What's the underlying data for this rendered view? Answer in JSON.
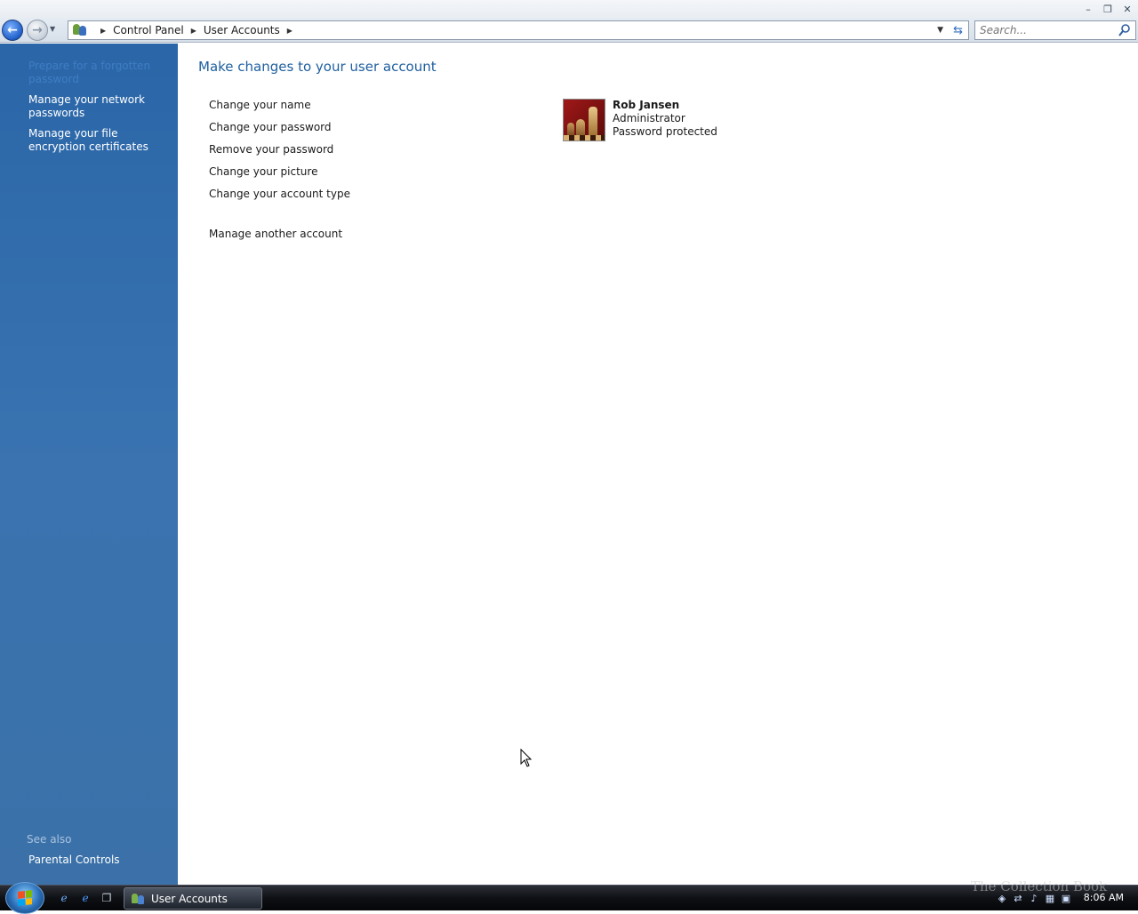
{
  "window": {
    "minimize_glyph": "–",
    "restore_glyph": "❐",
    "close_glyph": "✕"
  },
  "nav": {
    "back_glyph": "←",
    "forward_glyph": "→",
    "breadcrumbs": [
      "Control Panel",
      "User Accounts"
    ],
    "search_placeholder": "Search..."
  },
  "sidebar": {
    "tasks": [
      {
        "label": "Prepare for a forgotten password",
        "faded": true
      },
      {
        "label": "Manage your network passwords",
        "faded": false
      },
      {
        "label": "Manage your file encryption certificates",
        "faded": false
      }
    ],
    "see_also_label": "See also",
    "see_also_items": [
      "Parental Controls"
    ]
  },
  "main": {
    "title": "Make changes to your user account",
    "tasks": [
      "Change your name",
      "Change your password",
      "Remove your password",
      "Change your picture",
      "Change your account type"
    ],
    "other_task": "Manage another account",
    "account": {
      "name": "Rob Jansen",
      "role": "Administrator",
      "status": "Password protected"
    }
  },
  "taskbar": {
    "active_window": "User Accounts",
    "clock": "8:06 AM",
    "watermark": "The Collection Book"
  },
  "colors": {
    "sidebar": "#2a66a8",
    "title": "#1e5f9e",
    "faded_link": "#3f7cc4"
  }
}
